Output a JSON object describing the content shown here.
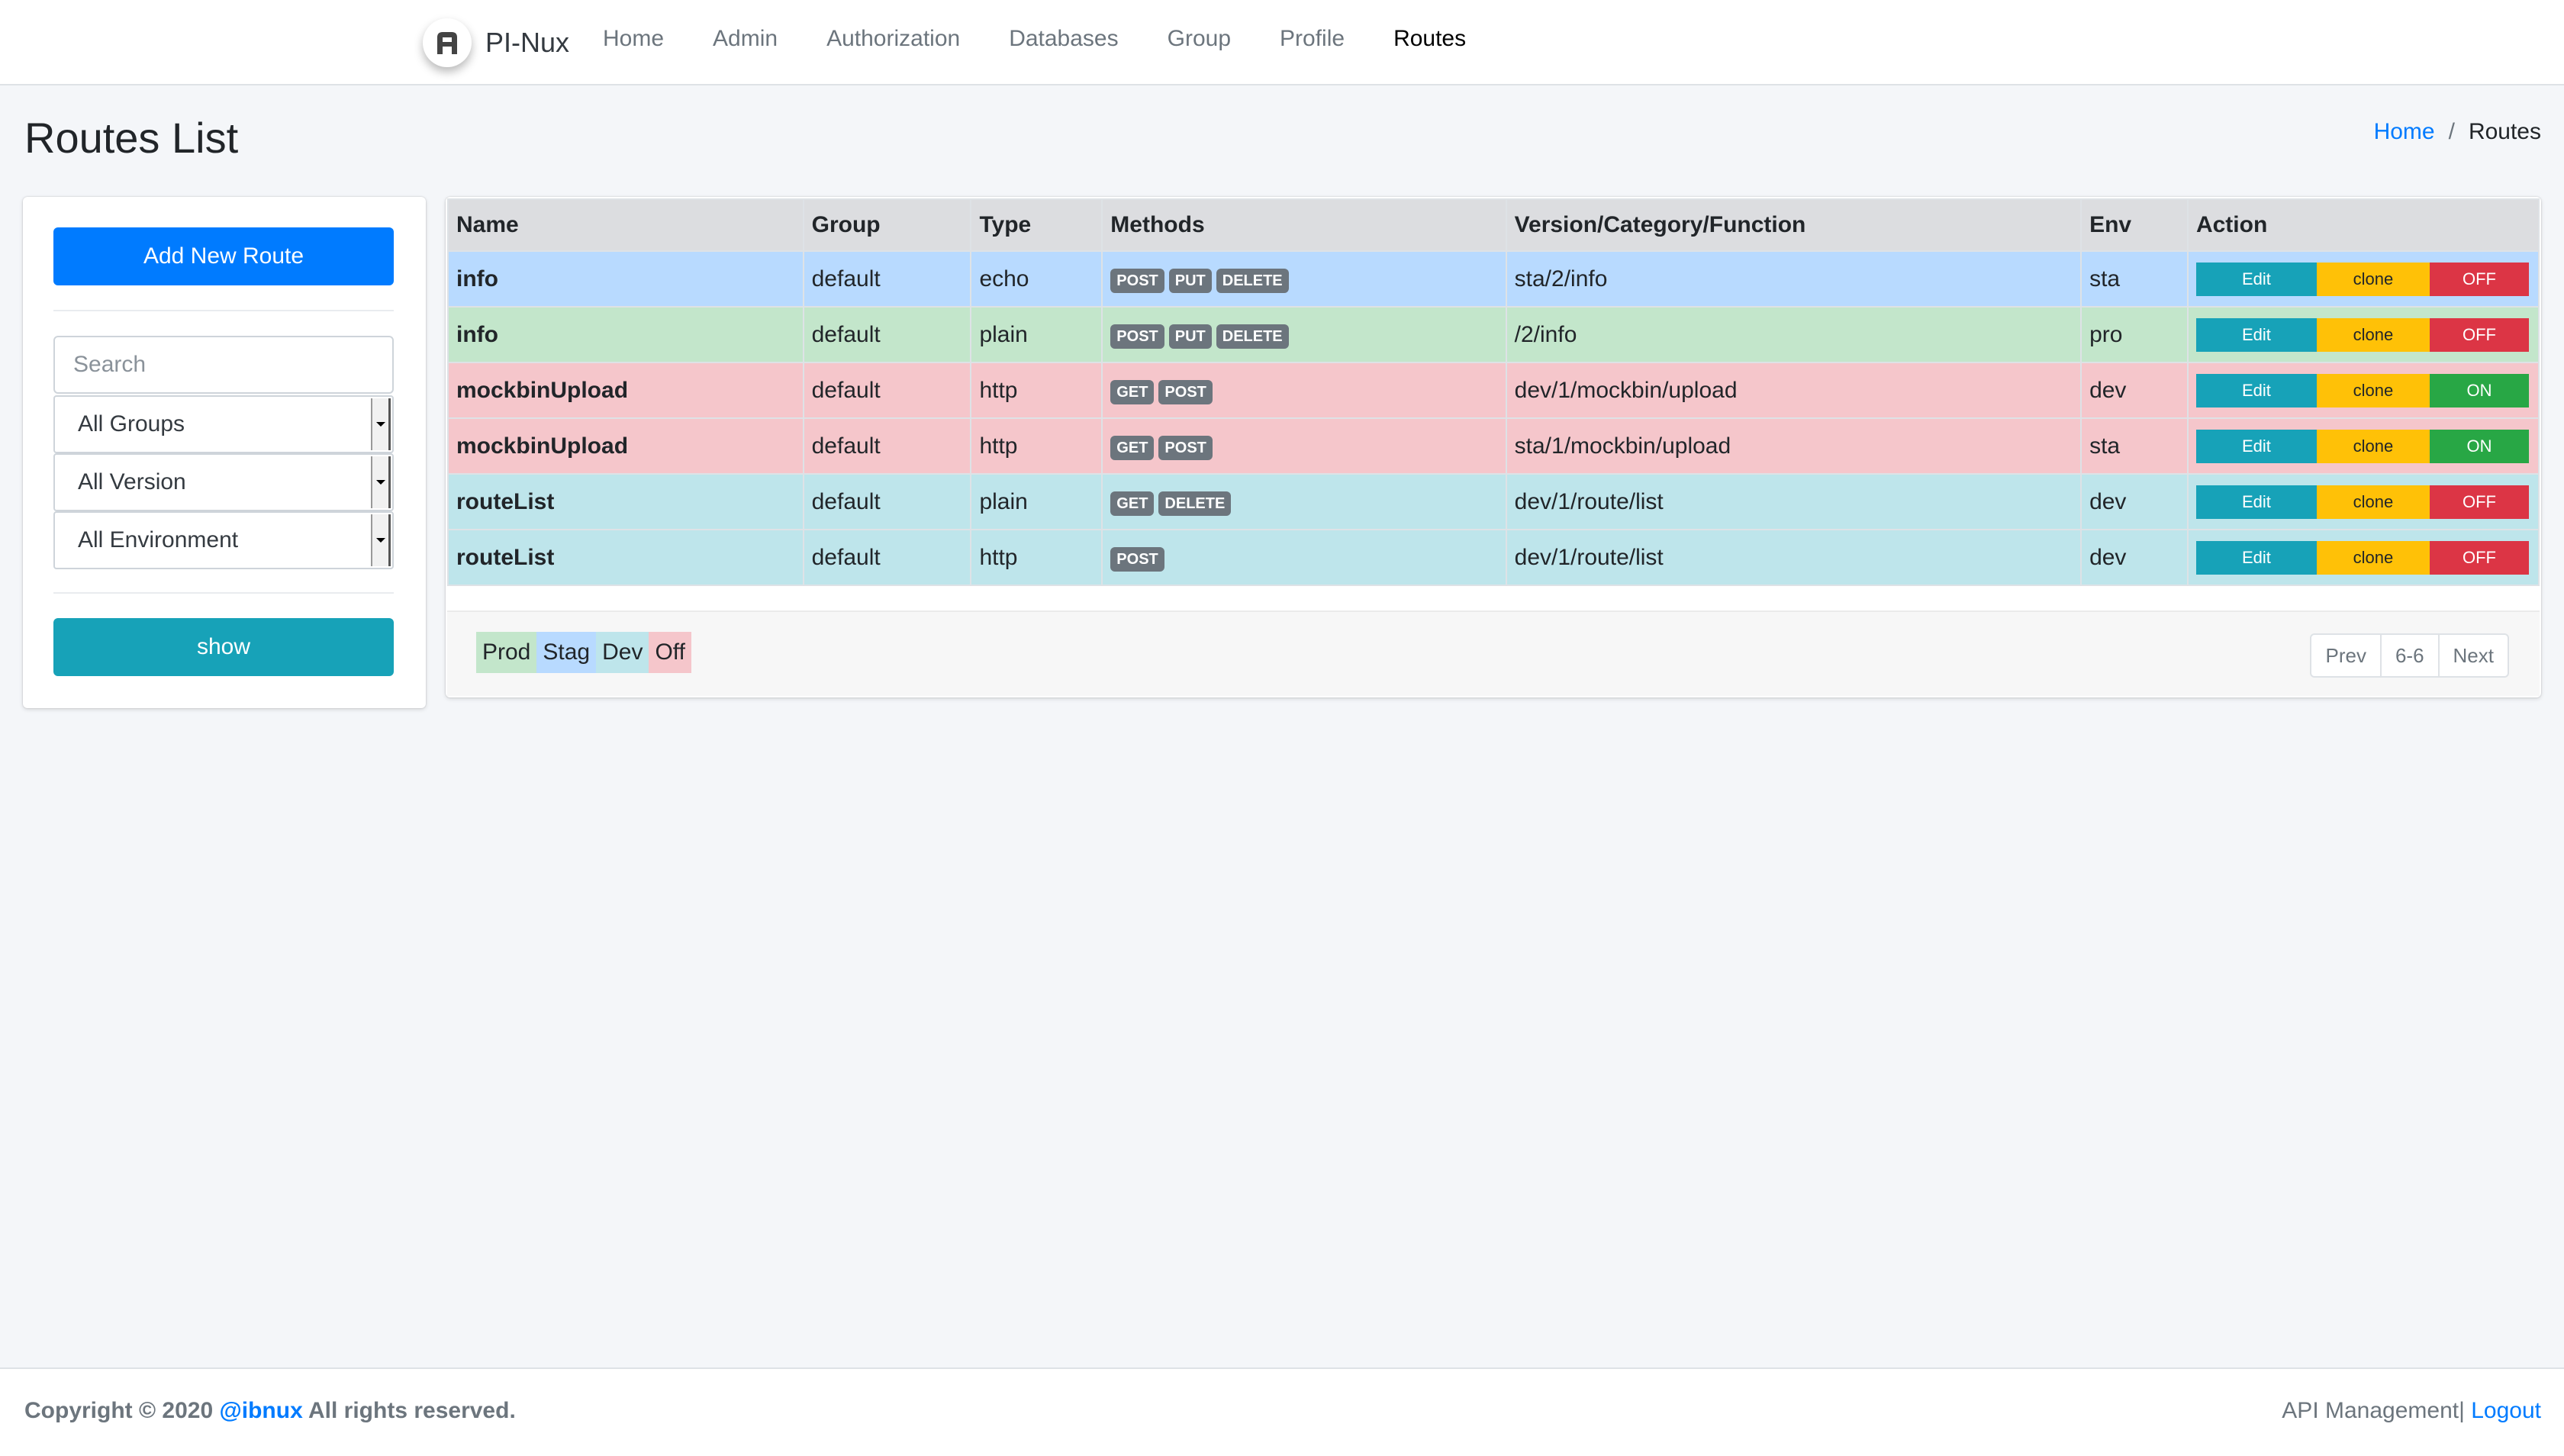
{
  "navbar": {
    "brand": "PI-Nux",
    "links": [
      {
        "label": "Home"
      },
      {
        "label": "Admin"
      },
      {
        "label": "Authorization"
      },
      {
        "label": "Databases"
      },
      {
        "label": "Group"
      },
      {
        "label": "Profile"
      },
      {
        "label": "Routes",
        "active": true
      }
    ]
  },
  "page": {
    "title": "Routes List",
    "breadcrumb": {
      "home": "Home",
      "separator": "/",
      "current": "Routes"
    }
  },
  "sidebar": {
    "add_button": "Add New Route",
    "search_placeholder": "Search",
    "group_select": "All Groups",
    "version_select": "All Version",
    "environment_select": "All Environment",
    "show_button": "show"
  },
  "table": {
    "columns": [
      "Name",
      "Group",
      "Type",
      "Methods",
      "Version/Category/Function",
      "Env",
      "Action"
    ],
    "rows": [
      {
        "name": "info",
        "group": "default",
        "type": "echo",
        "methods": [
          "POST",
          "PUT",
          "DELETE"
        ],
        "path": "sta/2/info",
        "env": "sta",
        "status_class": "stag",
        "toggle": "OFF"
      },
      {
        "name": "info",
        "group": "default",
        "type": "plain",
        "methods": [
          "POST",
          "PUT",
          "DELETE"
        ],
        "path": "/2/info",
        "env": "pro",
        "status_class": "prod",
        "toggle": "OFF"
      },
      {
        "name": "mockbinUpload",
        "group": "default",
        "type": "http",
        "methods": [
          "GET",
          "POST"
        ],
        "path": "dev/1/mockbin/upload",
        "env": "dev",
        "status_class": "off",
        "toggle": "ON"
      },
      {
        "name": "mockbinUpload",
        "group": "default",
        "type": "http",
        "methods": [
          "GET",
          "POST"
        ],
        "path": "sta/1/mockbin/upload",
        "env": "sta",
        "status_class": "off",
        "toggle": "ON"
      },
      {
        "name": "routeList",
        "group": "default",
        "type": "plain",
        "methods": [
          "GET",
          "DELETE"
        ],
        "path": "dev/1/route/list",
        "env": "dev",
        "status_class": "dev",
        "toggle": "OFF"
      },
      {
        "name": "routeList",
        "group": "default",
        "type": "http",
        "methods": [
          "POST"
        ],
        "path": "dev/1/route/list",
        "env": "dev",
        "status_class": "dev",
        "toggle": "OFF"
      }
    ],
    "action_labels": {
      "edit": "Edit",
      "clone": "clone"
    }
  },
  "legend": [
    {
      "label": "Prod",
      "color": "#c3e6cb"
    },
    {
      "label": "Stag",
      "color": "#b8daff"
    },
    {
      "label": "Dev",
      "color": "#bee5eb"
    },
    {
      "label": "Off",
      "color": "#f5c6cb"
    }
  ],
  "pagination": {
    "prev": "Prev",
    "range": "6-6",
    "next": "Next"
  },
  "footer": {
    "copyright_prefix": "Copyright © 2020",
    "author": "@ibnux",
    "copyright_suffix": "All rights reserved.",
    "app_name": "API Management",
    "separator": "|",
    "logout": "Logout"
  },
  "colors": {
    "primary": "#007bff",
    "info": "#17a2b8",
    "warning": "#ffc107",
    "danger": "#dc3545",
    "success": "#28a745"
  }
}
